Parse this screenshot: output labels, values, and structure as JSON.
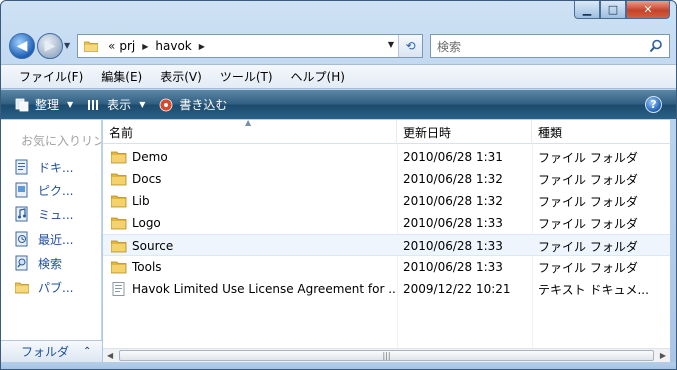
{
  "window": {
    "minimize_glyph": "▁",
    "maximize_glyph": "□",
    "close_glyph": "✕"
  },
  "nav": {
    "back_glyph": "◀",
    "forward_glyph": "▶"
  },
  "address": {
    "overflow": "«",
    "crumbs": [
      "prj",
      "havok"
    ],
    "dropdown_glyph": "▼",
    "refresh_glyph": "⟲"
  },
  "search": {
    "placeholder": "検索"
  },
  "menu": [
    "ファイル(F)",
    "編集(E)",
    "表示(V)",
    "ツール(T)",
    "ヘルプ(H)"
  ],
  "toolbar": {
    "organize": "整理",
    "views": "表示",
    "burn": "書き込む",
    "help_glyph": "?"
  },
  "nav_pane": {
    "header": "お気に入りリンク",
    "favorites": [
      "ドキ...",
      "ピク...",
      "ミュ...",
      "最近...",
      "検索",
      "パブ..."
    ],
    "folders_label": "フォルダ",
    "folders_chevron": "⌃"
  },
  "columns": {
    "name": "名前",
    "modified": "更新日時",
    "type": "種類"
  },
  "files": [
    {
      "name": "Demo",
      "modified": "2010/06/28 1:31",
      "type": "ファイル フォルダ",
      "kind": "folder"
    },
    {
      "name": "Docs",
      "modified": "2010/06/28 1:32",
      "type": "ファイル フォルダ",
      "kind": "folder"
    },
    {
      "name": "Lib",
      "modified": "2010/06/28 1:32",
      "type": "ファイル フォルダ",
      "kind": "folder"
    },
    {
      "name": "Logo",
      "modified": "2010/06/28 1:33",
      "type": "ファイル フォルダ",
      "kind": "folder"
    },
    {
      "name": "Source",
      "modified": "2010/06/28 1:33",
      "type": "ファイル フォルダ",
      "kind": "folder",
      "highlighted": true
    },
    {
      "name": "Tools",
      "modified": "2010/06/28 1:33",
      "type": "ファイル フォルダ",
      "kind": "folder"
    },
    {
      "name": "Havok Limited Use License Agreement for ...",
      "modified": "2009/12/22 10:21",
      "type": "テキスト ドキュメ...",
      "kind": "text"
    }
  ],
  "scrollbar": {
    "left_glyph": "◀",
    "right_glyph": "▶",
    "grip": "|||"
  }
}
